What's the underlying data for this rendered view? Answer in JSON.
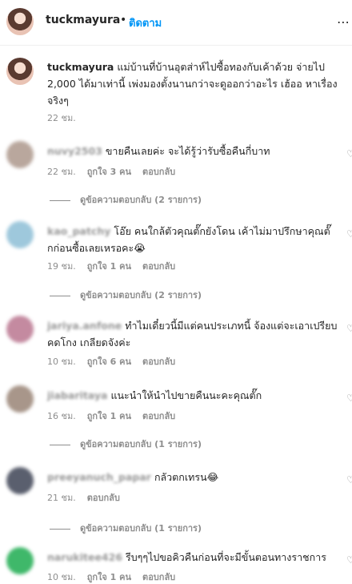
{
  "header": {
    "username": "tuckmayura",
    "dot": "•",
    "follow_label": "ติดตาม",
    "more_icon": "more-horizontal-icon"
  },
  "caption": {
    "username": "tuckmayura",
    "text": "แม่บ้านที่บ้านอุตส่าห์ไปซื้อทองกับเค้าด้วย จ่ายไป 2,000 ได้มาเท่านี้ เพ่งมองตั้งนานกว่าจะดูออกว่าอะไร เฮ้ออ หาเรื่องจริงๆ",
    "time": "22 ชม."
  },
  "comments": [
    {
      "username": "nuvy2503",
      "text": "ขายคืนเลยค่ะ จะได้รู้ว่ารับซื้อคืนกี่บาท",
      "time": "22 ชม.",
      "likes": "ถูกใจ 3 คน",
      "reply": "ตอบกลับ",
      "view_replies": "ดูข้อความตอบกลับ (2 รายการ)",
      "avatar_color": "#b9a79d"
    },
    {
      "username": "kao_patchy",
      "text": "โอ๊ย คนใกล้ตัวคุณตั๊กยังโดน เค้าไม่มาปรึกษาคุณตั๊กก่อนซื้อเลยเหรอคะ😭",
      "time": "19 ชม.",
      "likes": "ถูกใจ 1 คน",
      "reply": "ตอบกลับ",
      "view_replies": "ดูข้อความตอบกลับ (2 รายการ)",
      "avatar_color": "#9ec8dc"
    },
    {
      "username": "jariya.anfone",
      "text": "ทำไมเดี๋ยวนี้มีแต่คนประเภทนี้ จ้องแต่จะเอาเปรียบคดโกง เกลียดจังค่ะ",
      "time": "10 ชม.",
      "likes": "ถูกใจ 6 คน",
      "reply": "ตอบกลับ",
      "view_replies": "",
      "avatar_color": "#c48aa0"
    },
    {
      "username": "jiabaritaya",
      "text": "แนะนำให้นำไปขายคืนนะคะคุณตั๊ก",
      "time": "16 ชม.",
      "likes": "ถูกใจ 1 คน",
      "reply": "ตอบกลับ",
      "view_replies": "ดูข้อความตอบกลับ (1 รายการ)",
      "avatar_color": "#a8968a"
    },
    {
      "username": "preeyanuch_papar",
      "text": "กลัวตกเทรน😂",
      "time": "21 ชม.",
      "likes": "",
      "reply": "ตอบกลับ",
      "view_replies": "ดูข้อความตอบกลับ (1 รายการ)",
      "avatar_color": "#5a5f6e"
    },
    {
      "username": "narukitee426",
      "text": "รีบๆๆไปขอคิวคืนก่อนที่จะมีขั้นตอนทางราชการ",
      "time": "10 ชม.",
      "likes": "ถูกใจ 1 คน",
      "reply": "ตอบกลับ",
      "view_replies": "",
      "avatar_color": "#3fb86a"
    }
  ]
}
